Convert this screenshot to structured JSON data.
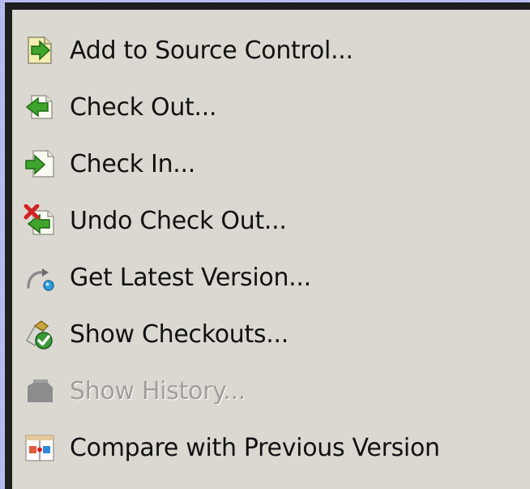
{
  "menu": {
    "items": [
      {
        "label": "Add to Source Control...",
        "icon": "add-to-source-control-icon",
        "enabled": true
      },
      {
        "label": "Check Out...",
        "icon": "check-out-icon",
        "enabled": true
      },
      {
        "label": "Check In...",
        "icon": "check-in-icon",
        "enabled": true
      },
      {
        "label": "Undo Check Out...",
        "icon": "undo-check-out-icon",
        "enabled": true
      },
      {
        "label": "Get Latest Version...",
        "icon": "get-latest-version-icon",
        "enabled": true
      },
      {
        "label": "Show Checkouts...",
        "icon": "show-checkouts-icon",
        "enabled": true
      },
      {
        "label": "Show History...",
        "icon": "show-history-icon",
        "enabled": false
      },
      {
        "label": "Compare with Previous Version",
        "icon": "compare-icon",
        "enabled": true
      }
    ]
  },
  "colors": {
    "menu_background": "#dbd8d1",
    "menu_border": "#1e1e1e",
    "text": "#111111",
    "disabled_text": "#a19f9a",
    "arrow_green": "#3fa32c",
    "remove_red": "#d42222",
    "desktop_blue": "#b9bdf2"
  }
}
